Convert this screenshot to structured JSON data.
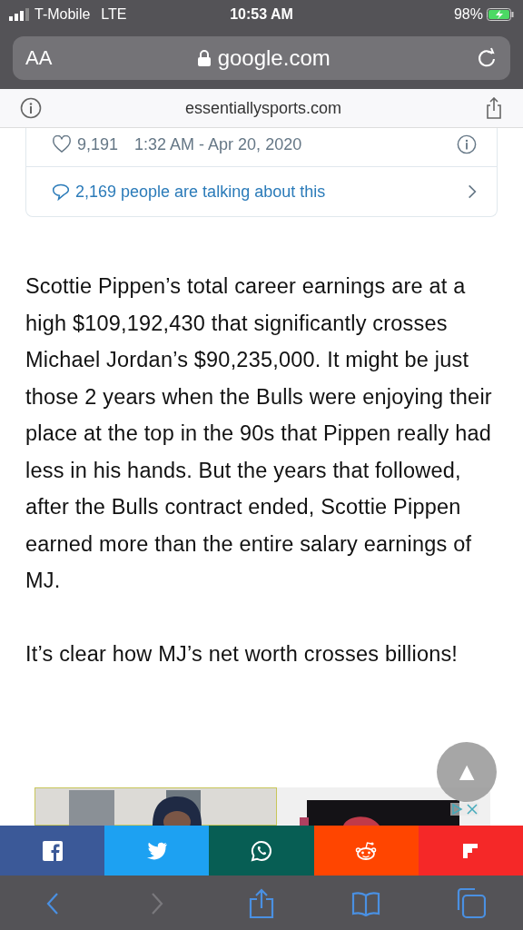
{
  "status_bar": {
    "carrier": "T-Mobile",
    "network": "LTE",
    "time": "10:53 AM",
    "battery": "98%",
    "charging": true
  },
  "url_bar": {
    "text_size": "AA",
    "address": "google.com",
    "secure": true
  },
  "site_bar": {
    "domain": "essentiallysports.com"
  },
  "tweet": {
    "likes": "9,191",
    "timestamp": "1:32 AM - Apr 20, 2020",
    "talking": "2,169 people are talking about this"
  },
  "article": {
    "paragraphs": [
      "Scottie Pippen’s total career earnings are at a high $109,192,430 that significantly crosses Michael Jordan’s $90,235,000. It might be just those 2 years when the Bulls were enjoying their place at the top in the 90s that Pippen really had less in his hands. But the years that followed, after the Bulls contract ended, Scottie Pippen earned more than the entire salary earnings of MJ.",
      "It’s clear how MJ’s net worth crosses billions!"
    ]
  },
  "scroll_top": {
    "label": "▲"
  },
  "share_buttons": [
    {
      "kind": "facebook",
      "color": "#3b5998"
    },
    {
      "kind": "twitter",
      "color": "#1da1f2"
    },
    {
      "kind": "whatsapp",
      "color": "#075e54"
    },
    {
      "kind": "reddit",
      "color": "#ff4500"
    },
    {
      "kind": "flipboard",
      "color": "#f52828"
    }
  ],
  "toolbar": [
    {
      "kind": "back",
      "disabled": false
    },
    {
      "kind": "forward",
      "disabled": true
    },
    {
      "kind": "share",
      "disabled": false
    },
    {
      "kind": "bookmarks",
      "disabled": false
    },
    {
      "kind": "tabs",
      "disabled": false
    }
  ]
}
